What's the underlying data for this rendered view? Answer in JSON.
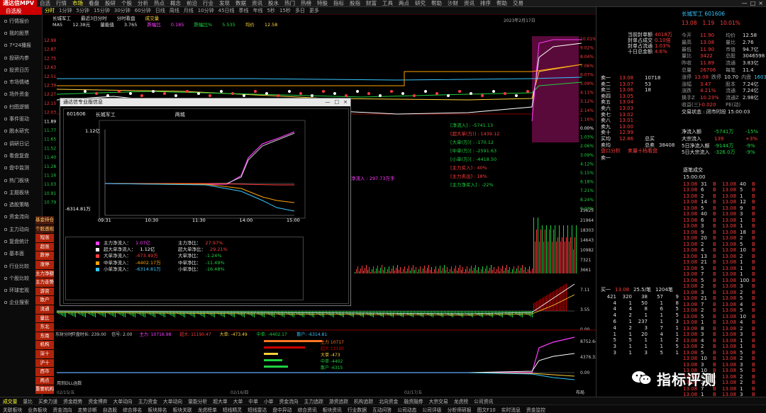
{
  "app": {
    "logo": "通达信MPV"
  },
  "menu": [
    "自选",
    "行情",
    "市场",
    "看盘",
    "股研",
    "个股",
    "分析",
    "热点",
    "概念",
    "前沿",
    "行业",
    "发现",
    "数据",
    "资讯",
    "股水",
    "热门",
    "热榜",
    "特股",
    "指标",
    "股指",
    "财富",
    "工具",
    "两点",
    "研究",
    "帮助",
    "沙财",
    "资讯",
    "排序",
    "帮助",
    "交易"
  ],
  "menu_active": 2,
  "window_controls": [
    "—",
    "□",
    "×"
  ],
  "periods": [
    "分时",
    "1分钟",
    "5分钟",
    "15分钟",
    "30分钟",
    "60分钟",
    "日线",
    "周线",
    "月线",
    "10分钟",
    "45日线",
    "季线",
    "年线",
    "5秒",
    "15秒",
    "多日",
    "更多"
  ],
  "periods_active": 0,
  "right_tools": [
    "高阶",
    "叠加",
    "股样",
    "画线",
    "标记",
    "+自选",
    "退出"
  ],
  "leftnav": {
    "header": "自选股",
    "items": [
      "行情报价",
      "我的股票",
      "7*24播报",
      "投研内参",
      "投资日历",
      "市场情绪",
      "场外资金",
      "扫图逻辑",
      "事件驱动",
      "脱水研究",
      "调研日记",
      "看盘复盘",
      "盘中监测",
      "热门板块",
      "主题板块",
      "选股策略",
      "资金流向",
      "主力动向",
      "复盘统计",
      "基本面",
      "行业比较",
      "个股比较",
      "环球宏观",
      "企业搜索"
    ]
  },
  "vtabs": [
    "基金持仓",
    "个股透视",
    "短涨",
    "超涨",
    "跌停",
    "涨停",
    "主力净额",
    "主力走势",
    "游资",
    "散户",
    "流通",
    "量比",
    "东北",
    "东南",
    "机构",
    "深十",
    "沪十",
    "西市",
    "两点",
    "重要机构"
  ],
  "chart": {
    "stock_name": "长城军工",
    "info1": [
      "最近3日分时",
      "分时看盘",
      "成交量"
    ],
    "info2": [
      "MA5",
      "12.38元",
      "量能值",
      "3.765",
      "跌幅比",
      "0.185",
      "跌幅比%",
      "5.535",
      "均价",
      "12.58"
    ],
    "date": "2023年2月17日",
    "price_ticks": [
      "12.99",
      "12.87",
      "12.75",
      "12.63",
      "12.51",
      "12.39",
      "12.27",
      "12.15",
      "12.03",
      "11.89",
      "11.77",
      "11.65",
      "11.52",
      "11.40",
      "11.28",
      "11.16",
      "11.03",
      "10.91",
      "10.79"
    ],
    "pct_ticks": [
      "10.01%",
      "9.02%",
      "8.04%",
      "7.06%",
      "6.07%",
      "5.09%",
      "4.11%",
      "3.12%",
      "2.14%",
      "1.16%",
      "0.00%",
      "1.03%",
      "2.06%",
      "3.09%",
      "4.12%",
      "5.15%",
      "6.18%",
      "7.21%",
      "8.24%",
      "9.27%"
    ],
    "vol_ticks": [
      "25625",
      "21964",
      "18303",
      "14643",
      "10982",
      "7321",
      "3661"
    ],
    "macd_ticks": [
      "7.11",
      "3.55",
      "0.00"
    ],
    "flow_labels": [
      "[净流入] : -5741.13",
      "[超大单(万)] : 1439.12",
      "[大单(万)] : -170.12",
      "[中单(万)] : -2591.63",
      "[小单(万)] : -4418.50",
      "[主力买入] : 40%",
      "[主力卖出] : 18%",
      "[主力净买入] : -22%"
    ],
    "annot": "净流入 : 297.73万手",
    "lower_info": [
      "东财分时",
      "开盘时长: 239.00",
      "信号: 2.00",
      "主力: 10716.98",
      "超大: 11190.47",
      "大单: -473.49",
      "中单: -4402.17",
      "散户: -6314.81"
    ],
    "lower_legend": [
      "主力 10717",
      "超大 11190",
      "大单 -473",
      "中单 -4402",
      "散户 -6315"
    ],
    "lower_ticks": [
      "8752.64",
      "4376.32",
      "0.00"
    ],
    "bottom_label": "用到DLL函数",
    "bottom_right": "布局",
    "x_dates": [
      "02/15/五",
      "02/16/四",
      "02/17/五"
    ]
  },
  "popup": {
    "title": "通达信专业版信息",
    "buttons": [
      "—",
      "□",
      "×"
    ],
    "code": "601606",
    "name": "长城军工",
    "period": "两城",
    "y_top": "1.12亿",
    "y_bottom": "-6314.81万",
    "x_ticks": [
      "09:31",
      "10:30",
      "11:30",
      "14:00",
      "15:00"
    ],
    "legend_left": [
      {
        "label": "主力净流入",
        "value": "1.07亿",
        "color": "#ff3cff"
      },
      {
        "label": "超大单净流入",
        "value": "1.12亿",
        "color": "#ffffff"
      },
      {
        "label": "大单净流入",
        "value": "-473.49万",
        "color": "#ff3b3b"
      },
      {
        "label": "中单净流入",
        "value": "-4402.17万",
        "color": "#ffa500"
      },
      {
        "label": "小单净流入",
        "value": "-6314.81万",
        "color": "#36c6ff"
      }
    ],
    "legend_right": [
      {
        "label": "主力净比",
        "value": "27.97%"
      },
      {
        "label": "超大单净比",
        "value": "29.21%"
      },
      {
        "label": "大单净比",
        "value": "-1.24%"
      },
      {
        "label": "中单净比",
        "value": "-11.49%"
      },
      {
        "label": "小单净比",
        "value": "-16.48%"
      }
    ]
  },
  "quote": {
    "name_code": "长城军工 601606",
    "price": "13.08",
    "chg": "1.19",
    "pct": "10.01%",
    "fields_left": [
      [
        "今开",
        "11.90"
      ],
      [
        "最高",
        "13.08"
      ],
      [
        "最低",
        "11.90"
      ],
      [
        "量比",
        "3422"
      ],
      [
        "昨收",
        "11.89"
      ],
      [
        "总量",
        "26706"
      ]
    ],
    "fields_right": [
      [
        "均价",
        "12.58"
      ],
      [
        "量比",
        "2.76"
      ],
      [
        "市值",
        "94.7亿"
      ],
      [
        "总股",
        "3046598"
      ],
      [
        "流通",
        "3.83亿"
      ],
      [
        "每笔",
        "11.4"
      ]
    ],
    "fields_more_left": [
      [
        "涨停",
        "13.08"
      ],
      [
        "涨幅",
        "3.47"
      ],
      [
        "涨跌",
        "4.21%"
      ],
      [
        "换手Z",
        "10.23%"
      ],
      [
        "收益(三)",
        "-0.020"
      ]
    ],
    "fields_more_mid": [
      [
        "跌停",
        "10.70"
      ],
      [
        "股本",
        "7.24亿"
      ],
      [
        "流通",
        "7.24亿"
      ],
      [
        "流通Z",
        "2.98亿"
      ],
      [
        "PE(动)",
        ""
      ]
    ],
    "fields_more_right": [
      [
        "内盘",
        "160384"
      ]
    ],
    "stage": "交易状态 : 闭市时段 15:00:03",
    "flows": [
      [
        "净流入额",
        "-5741万",
        "-15%"
      ],
      [
        "大宗流入",
        "139",
        "+3%"
      ],
      [
        "5日净流入额",
        "-9144万",
        "-9%"
      ],
      [
        "5日大宗流入",
        "-326.0万",
        "-9%"
      ]
    ],
    "asks": [
      [
        "卖十",
        "",
        ""
      ],
      [
        "卖九",
        "",
        ""
      ],
      [
        "卖八",
        "",
        ""
      ],
      [
        "卖七",
        "",
        ""
      ],
      [
        "卖六",
        "",
        ""
      ],
      [
        "卖五",
        "",
        ""
      ],
      [
        "卖四",
        "",
        ""
      ],
      [
        "卖三",
        "",
        ""
      ],
      [
        "卖二",
        "",
        ""
      ],
      [
        "卖一",
        "13.08",
        "10718"
      ]
    ],
    "limit_info": [
      [
        "当前封单额",
        "4018万"
      ],
      [
        "封单占成交",
        "0.10倍"
      ],
      [
        "封单占流通",
        "1.03%"
      ],
      [
        "十日总金额",
        "4.6%"
      ]
    ],
    "price_pairs": [
      [
        "13.07",
        "53"
      ],
      [
        "13.06",
        "18"
      ],
      [
        "13.05",
        ""
      ],
      [
        "13.04",
        ""
      ],
      [
        "13.03",
        ""
      ],
      [
        "13.02",
        ""
      ],
      [
        "13.01",
        ""
      ],
      [
        "13.00",
        ""
      ],
      [
        "12.99",
        ""
      ]
    ],
    "buys": [
      [
        "买一",
        "13.08",
        ""
      ],
      [
        "买二",
        "",
        ""
      ],
      [
        "买三",
        "",
        ""
      ],
      [
        "买四",
        "",
        ""
      ],
      [
        "买五",
        "",
        ""
      ],
      [
        "买六",
        "",
        ""
      ],
      [
        "买七",
        "",
        ""
      ],
      [
        "买八",
        "",
        ""
      ],
      [
        "买九",
        "",
        ""
      ],
      [
        "买十",
        "",
        ""
      ]
    ],
    "misc_rows": [
      [
        "买均",
        "12.86",
        "总买",
        ""
      ],
      [
        "卖均",
        "",
        "总卖",
        "38408"
      ]
    ],
    "tabs_mid": [
      "盘口分析",
      "卖量十档看盘"
    ],
    "tabs_mid2": [
      "卖一",
      ""
    ],
    "weibi": "委比",
    "order_row": [
      "买一",
      "13.08",
      "25.5/笔",
      "1204笔"
    ],
    "order_grid": [
      [
        "421",
        "320",
        "38",
        "57",
        "9"
      ],
      [
        "4",
        "1",
        "50",
        "1",
        "8"
      ],
      [
        "4",
        "4",
        "8",
        "6",
        "5"
      ],
      [
        "4",
        "2",
        "1",
        "1",
        "5"
      ],
      [
        "6",
        "1",
        "237",
        "1",
        "3"
      ],
      [
        "4",
        "2",
        "3",
        "7",
        "1"
      ],
      [
        "1",
        "1",
        "20",
        "4",
        "1"
      ],
      [
        "5",
        "5",
        "1",
        "1",
        "2"
      ],
      [
        "3",
        "1",
        "1",
        "1",
        "5"
      ],
      [
        "3",
        "1",
        "3",
        "5",
        "1"
      ]
    ],
    "trades_header": "逐笔成交",
    "trades_time": "15:00:00",
    "trades": [
      [
        "13.08",
        "B",
        "31"
      ],
      [
        "13.08",
        "B",
        "6"
      ],
      [
        "13.08",
        "B",
        "2"
      ],
      [
        "13.08",
        "B",
        "14"
      ],
      [
        "13.08",
        "B",
        "5"
      ],
      [
        "13.08",
        "B",
        "40"
      ],
      [
        "13.08",
        "B",
        "6"
      ],
      [
        "13.08",
        "B",
        "3"
      ],
      [
        "13.08",
        "B",
        "9"
      ],
      [
        "13.08",
        "B",
        "20"
      ],
      [
        "13.08",
        "B",
        "2"
      ],
      [
        "13.08",
        "B",
        "4"
      ],
      [
        "13.08",
        "B",
        "13"
      ],
      [
        "13.08",
        "B",
        "21"
      ],
      [
        "13.08",
        "B",
        "5"
      ],
      [
        "13.08",
        "B",
        "7"
      ],
      [
        "13.08",
        "B",
        "5"
      ],
      [
        "13.08",
        "B",
        "2"
      ],
      [
        "13.08",
        "B",
        "3"
      ],
      [
        "13.08",
        "B",
        "21"
      ],
      [
        "13.08",
        "B",
        "7"
      ],
      [
        "13.08",
        "B",
        "2"
      ],
      [
        "13.08",
        "B",
        "5"
      ],
      [
        "13.08",
        "B",
        "1"
      ],
      [
        "13.08",
        "B",
        "8"
      ],
      [
        "13.08",
        "B",
        "3"
      ],
      [
        "13.08",
        "B",
        "4"
      ],
      [
        "13.08",
        "B",
        "2"
      ],
      [
        "13.08",
        "B",
        "5"
      ],
      [
        "13.08",
        "B",
        "10"
      ],
      [
        "13.08",
        "B",
        "3"
      ],
      [
        "13.08",
        "B",
        "10"
      ],
      [
        "13.08",
        "B",
        "6"
      ],
      [
        "13.08",
        "B",
        "2"
      ],
      [
        "13.08",
        "B",
        "7"
      ],
      [
        "13.08",
        "B",
        "1"
      ]
    ],
    "trades_col2": [
      "40",
      "5",
      "1",
      "12",
      "9",
      "3",
      "1",
      "1",
      "18",
      "2",
      "5",
      "10",
      "2",
      "1",
      "1",
      "1",
      "100",
      "3",
      "2",
      "5",
      "4",
      "5",
      "10",
      "4",
      "2",
      "3",
      "1",
      "1",
      "5",
      "2",
      "3",
      "5",
      "2",
      "2",
      "1",
      "3"
    ],
    "bottom_tabs": [
      "队列",
      "分价",
      "盘成",
      "明细",
      "大单",
      "ABS"
    ]
  },
  "bottombar1": [
    "成交量",
    "量比",
    "买卖力道",
    "资金趋势",
    "资金博弈",
    "大单动向",
    "主力资金",
    "大单动向",
    "量能分析",
    "超大单",
    "大单",
    "中单",
    "小单",
    "资金流向",
    "主力追踪",
    "游资追踪",
    "机构追踪",
    "北向资金",
    "融资融券",
    "大宗交易",
    "龙虎榜",
    "公司资讯"
  ],
  "bottombar2": [
    "关联板块",
    "业务板块",
    "资金流向",
    "走势诊断",
    "自选股",
    "综合排名",
    "板块排名",
    "板块关联",
    "龙虎榜单",
    "短线精灵",
    "短线雷达",
    "盘中异动",
    "综合资讯",
    "板块资讯",
    "行业数据",
    "互动问答",
    "公司动态",
    "公司评级",
    "分析师研报",
    "图文F10",
    "实时消息",
    "资金监控"
  ],
  "bottombar1_active": 0,
  "watermark": "指标评测"
}
